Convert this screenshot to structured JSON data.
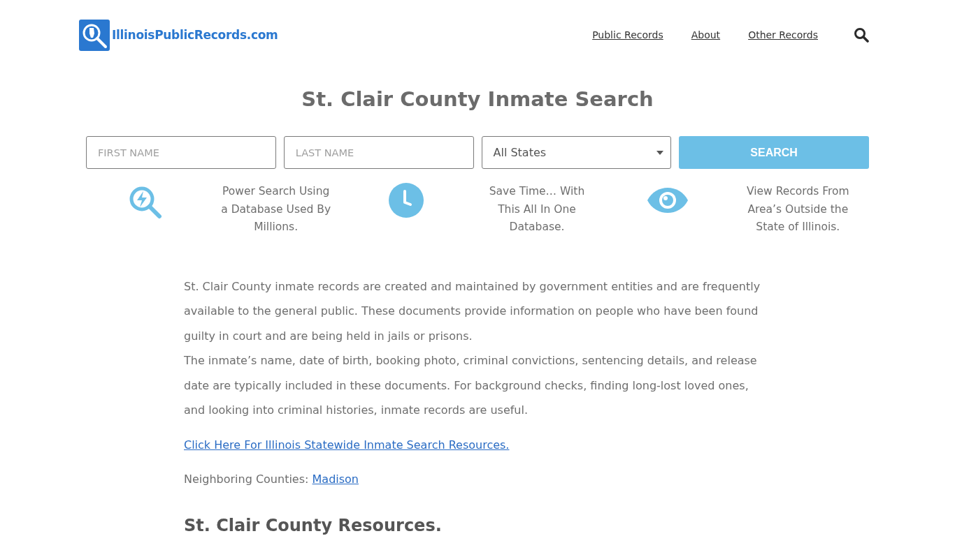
{
  "header": {
    "logo_text": "IllinoisPublicRecords.com",
    "nav": [
      {
        "label": "Public Records"
      },
      {
        "label": "About"
      },
      {
        "label": "Other Records"
      }
    ]
  },
  "title": "St. Clair County Inmate Search",
  "search_form": {
    "first_name": {
      "placeholder": "FIRST NAME"
    },
    "last_name": {
      "placeholder": "LAST NAME"
    },
    "state": {
      "value": "All States"
    },
    "button": "SEARCH"
  },
  "features": [
    {
      "kind": "power-search",
      "text": "Power Search Using a Database Used By Millions."
    },
    {
      "kind": "clock",
      "text": "Save Time… With This All In One Database."
    },
    {
      "kind": "eye",
      "text": "View Records From Area’s Outside the State of Illinois."
    }
  ],
  "paragraphs": [
    "St. Clair County inmate records are created and maintained by government entities and are frequently available to the general public. These documents provide information on people who have been found guilty in court and are being held in jails or prisons.",
    "The inmate’s name, date of birth, booking photo, criminal convictions, sentencing details, and release date are typically included in these documents. For background checks, finding long-lost loved ones, and looking into criminal histories, inmate records are useful."
  ],
  "statewide_link": "Click Here For Illinois Statewide Inmate Search Resources.",
  "neighboring": {
    "label": "Neighboring Counties:",
    "counties": [
      "Madison"
    ]
  },
  "resources_heading": "St. Clair County Resources."
}
